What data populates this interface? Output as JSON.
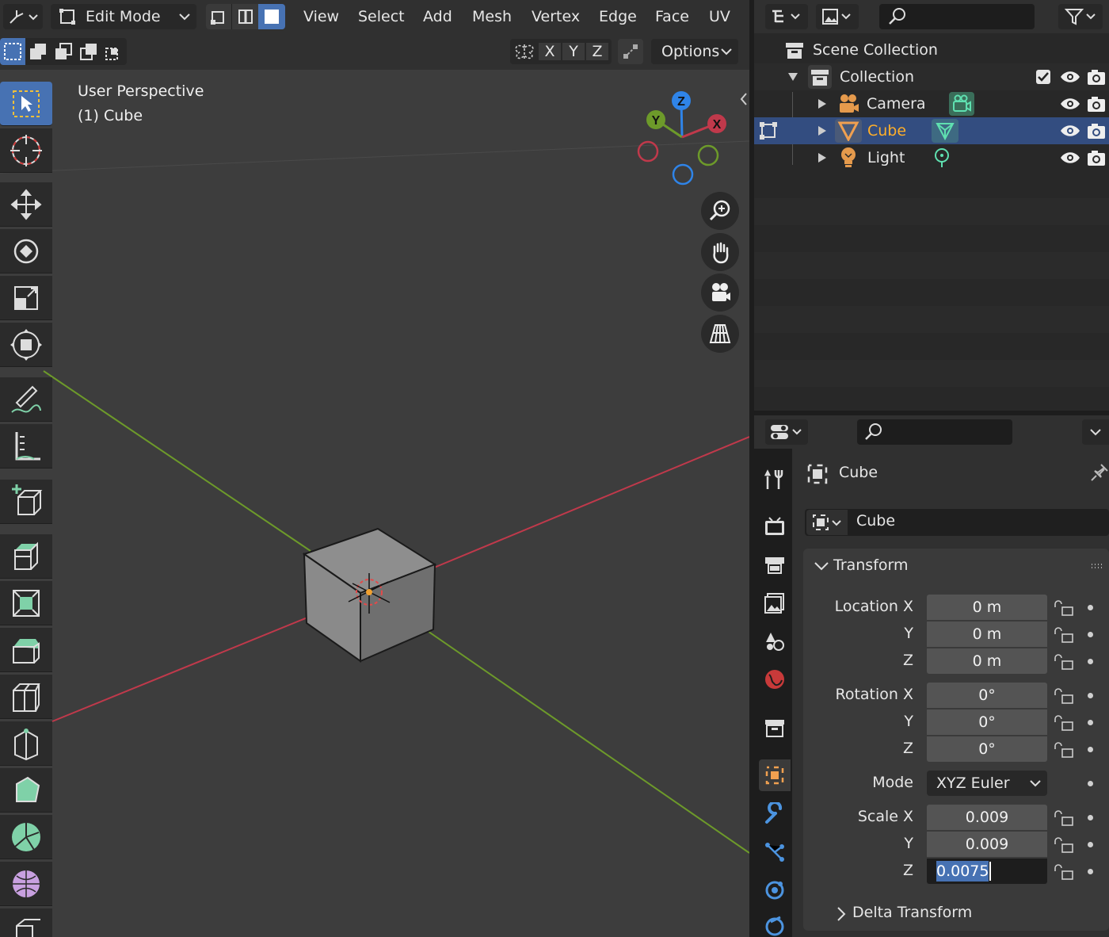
{
  "header": {
    "mode_label": "Edit Mode",
    "menus": [
      "View",
      "Select",
      "Add",
      "Mesh",
      "Vertex",
      "Edge",
      "Face",
      "UV"
    ],
    "axis_x": "X",
    "axis_y": "Y",
    "axis_z": "Z",
    "options_label": "Options"
  },
  "viewport": {
    "view_name": "User Perspective",
    "object_label": "(1) Cube",
    "gizmo": {
      "x": "X",
      "y": "Y",
      "z": "Z"
    }
  },
  "outliner": {
    "scene_collection": "Scene Collection",
    "collection": "Collection",
    "items": [
      {
        "label": "Camera"
      },
      {
        "label": "Cube"
      },
      {
        "label": "Light"
      }
    ]
  },
  "properties": {
    "object_name": "Cube",
    "datablock_name": "Cube",
    "transform_title": "Transform",
    "location_label": "Location X",
    "rotation_label": "Rotation X",
    "mode_label": "Mode",
    "scale_label": "Scale X",
    "y_label": "Y",
    "z_label": "Z",
    "location": {
      "x": "0 m",
      "y": "0 m",
      "z": "0 m"
    },
    "rotation": {
      "x": "0°",
      "y": "0°",
      "z": "0°"
    },
    "rotation_mode": "XYZ Euler",
    "scale": {
      "x": "0.009",
      "y": "0.009",
      "z": "0.0075"
    },
    "delta_title": "Delta Transform"
  },
  "colors": {
    "accent": "#4772b3",
    "axis_x": "#c0394b",
    "axis_y": "#6d9a2a",
    "axis_z": "#2f84e8",
    "selected_text": "#ffaf29"
  }
}
